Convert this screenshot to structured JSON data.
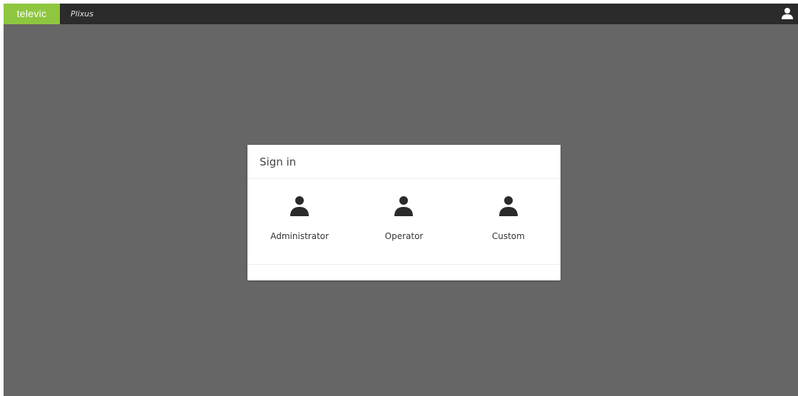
{
  "header": {
    "logo_text": "televic",
    "app_name": "Plixus",
    "user_icon": "user-icon"
  },
  "signin": {
    "title": "Sign in",
    "options": [
      {
        "label": "Administrator",
        "icon": "user-icon"
      },
      {
        "label": "Operator",
        "icon": "user-icon"
      },
      {
        "label": "Custom",
        "icon": "user-icon"
      }
    ]
  },
  "colors": {
    "brand_green": "#8ec63f",
    "topbar": "#2b2b2b",
    "backdrop": "#666666",
    "dialog_bg": "#ffffff",
    "icon": "#2b2b2b"
  }
}
